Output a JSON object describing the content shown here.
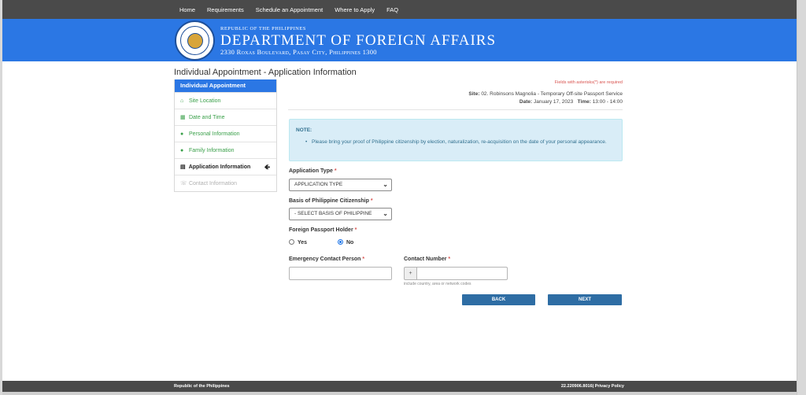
{
  "nav": {
    "items": [
      "Home",
      "Requirements",
      "Schedule an Appointment",
      "Where to Apply",
      "FAQ"
    ]
  },
  "header": {
    "subtitle": "Republic of the Philippines",
    "title": "DEPARTMENT OF FOREIGN AFFAIRS",
    "address": "2330 Roxas Boulevard, Pasay City, Philippines 1300"
  },
  "page": {
    "title": "Individual Appointment - Application Information"
  },
  "sidebar": {
    "header": "Individual Appointment",
    "items": [
      {
        "label": "Site Location",
        "icon": "home-icon"
      },
      {
        "label": "Date and Time",
        "icon": "calendar-icon"
      },
      {
        "label": "Personal Information",
        "icon": "user-icon"
      },
      {
        "label": "Family Information",
        "icon": "users-icon"
      },
      {
        "label": "Application Information",
        "icon": "card-icon"
      },
      {
        "label": "Contact Information",
        "icon": "phone-icon"
      }
    ]
  },
  "info": {
    "required_note": "Fields with asterisks(*) are required",
    "site_label": "Site:",
    "site_value": "02. Robinsons Magnolia - Temporary Off-site Passport Service",
    "date_label": "Date:",
    "date_value": "January 17, 2023",
    "time_label": "Time:",
    "time_value": "13:00 - 14:00"
  },
  "note": {
    "title": "NOTE:",
    "text": "Please bring your proof of Philippine citizenship by election, naturalization, re-acquisition on the date of your personal appearance."
  },
  "form": {
    "application_type": {
      "label": "Application Type",
      "value": "APPLICATION TYPE"
    },
    "citizenship": {
      "label": "Basis of Philippine Citizenship",
      "value": "- SELECT BASIS OF PHILIPPINE"
    },
    "foreign_passport": {
      "label": "Foreign Passport Holder",
      "yes": "Yes",
      "no": "No",
      "selected": "No"
    },
    "emergency_contact": {
      "label": "Emergency Contact Person",
      "value": ""
    },
    "contact_number": {
      "label": "Contact Number",
      "prefix": "+",
      "value": "",
      "hint": "include country, area or network codes"
    },
    "required_mark": "*"
  },
  "buttons": {
    "back": "BACK",
    "next": "NEXT"
  },
  "footer": {
    "left": "Republic of the Philippines",
    "right": "22.220906.8016| Privacy Policy"
  },
  "colors": {
    "brand_blue": "#2b77e4",
    "nav_gray": "#4a4a4a",
    "link_green": "#3aa04a",
    "button_blue": "#2e6da4"
  }
}
